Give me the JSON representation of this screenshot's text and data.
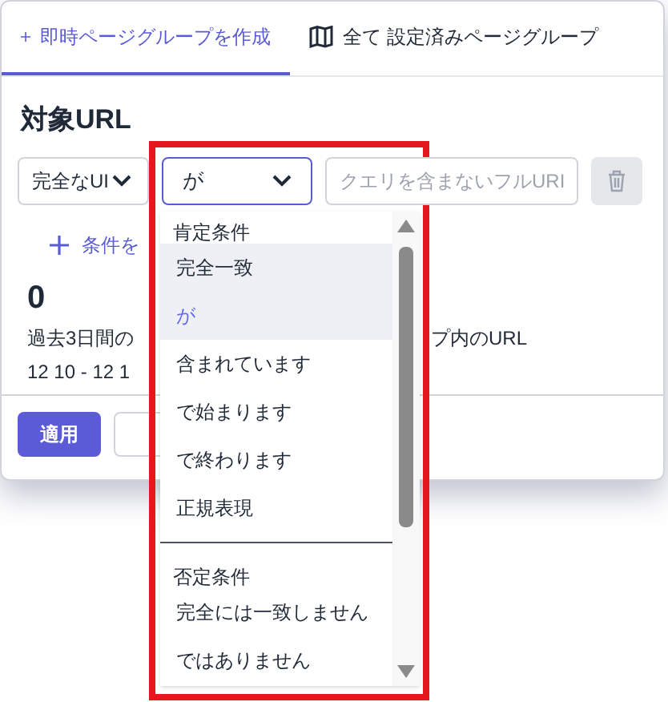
{
  "tabs": [
    {
      "label": "即時ページグループを作成",
      "selected": true
    },
    {
      "label": "全て 設定済みページグループ",
      "selected": false
    }
  ],
  "section_title": "対象URL",
  "condition_row": {
    "match_type": "完全なUI",
    "operator": "が",
    "url_placeholder": "クエリを含まないフルURI"
  },
  "add_condition": "条件を",
  "count": "0",
  "description_left": "過去3日間の",
  "description_right": "プ内のURL",
  "date_range": "12 10 - 12 1",
  "buttons": [
    {
      "label": "適用",
      "kind": "primary"
    },
    {
      "kind": "secondary"
    }
  ],
  "dropdown": {
    "groups": [
      {
        "label": "肯定条件",
        "options": [
          {
            "label": "完全一致",
            "selected": false,
            "highlighted": true
          },
          {
            "label": "が",
            "selected": true,
            "highlighted": true
          },
          {
            "label": "含まれています",
            "selected": false,
            "highlighted": false
          },
          {
            "label": "で始まります",
            "selected": false,
            "highlighted": false
          },
          {
            "label": "で終わります",
            "selected": false,
            "highlighted": false
          },
          {
            "label": "正規表現",
            "selected": false,
            "highlighted": false
          }
        ]
      },
      {
        "label": "否定条件",
        "options": [
          {
            "label": "完全には一致しません",
            "selected": false,
            "highlighted": false
          },
          {
            "label": "ではありません",
            "selected": false,
            "highlighted": false
          }
        ]
      }
    ]
  }
}
